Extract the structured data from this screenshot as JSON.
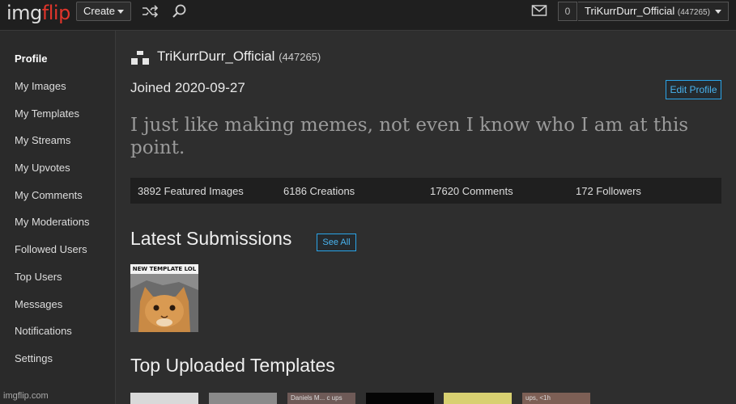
{
  "header": {
    "logo_part1": "img",
    "logo_part2": "flip",
    "create_label": "Create",
    "notification_count": "0",
    "username": "TriKurrDurr_Official",
    "points": "(447265)"
  },
  "sidebar": {
    "items": [
      {
        "label": "Profile",
        "active": true
      },
      {
        "label": "My Images"
      },
      {
        "label": "My Templates"
      },
      {
        "label": "My Streams"
      },
      {
        "label": "My Upvotes"
      },
      {
        "label": "My Comments"
      },
      {
        "label": "My Moderations"
      },
      {
        "label": "Followed Users"
      },
      {
        "label": "Top Users"
      },
      {
        "label": "Messages"
      },
      {
        "label": "Notifications"
      },
      {
        "label": "Settings"
      }
    ],
    "site_url": "imgflip.com"
  },
  "profile": {
    "username": "TriKurrDurr_Official",
    "points": "(447265)",
    "joined": "Joined 2020-09-27",
    "edit_label": "Edit Profile",
    "bio": "I just like making memes, not even I know who I am at this point."
  },
  "stats": [
    {
      "label": "3892 Featured Images"
    },
    {
      "label": "6186 Creations"
    },
    {
      "label": "17620 Comments"
    },
    {
      "label": "172 Followers"
    }
  ],
  "latest": {
    "title": "Latest Submissions",
    "see_all_label": "See All",
    "thumb_caption": "NEW TEMPLATE LOL"
  },
  "templates": {
    "title": "Top Uploaded Templates",
    "items": [
      {
        "label": "",
        "color": "#d9d9d9"
      },
      {
        "label": "",
        "color": "#8a8a8a"
      },
      {
        "label": "Daniels M... c ups",
        "color": "#6e5a57"
      },
      {
        "label": "",
        "color": "#050505"
      },
      {
        "label": "",
        "color": "#d8d071"
      },
      {
        "label": "ups, <1h",
        "color": "#7d5f55"
      }
    ]
  },
  "colors": {
    "accent": "#2aa4e8",
    "logo_red": "#e0352b"
  }
}
